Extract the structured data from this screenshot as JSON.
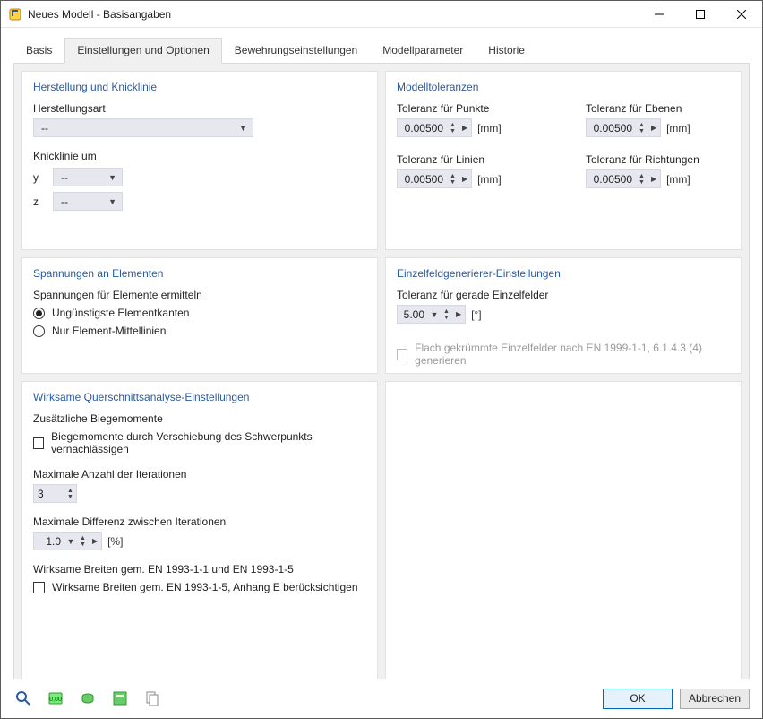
{
  "window": {
    "title": "Neues Modell - Basisangaben"
  },
  "tabs": {
    "basis": "Basis",
    "einstellungen": "Einstellungen und Optionen",
    "bewehrung": "Bewehrungseinstellungen",
    "modellparameter": "Modellparameter",
    "historie": "Historie"
  },
  "herstellung": {
    "title": "Herstellung und Knicklinie",
    "herstellungsart_label": "Herstellungsart",
    "herstellungsart_value": "--",
    "knicklinie_label": "Knicklinie um",
    "y_label": "y",
    "y_value": "--",
    "z_label": "z",
    "z_value": "--"
  },
  "toleranzen": {
    "title": "Modelltoleranzen",
    "punkte_label": "Toleranz für Punkte",
    "punkte_value": "0.00500",
    "ebenen_label": "Toleranz für Ebenen",
    "ebenen_value": "0.00500",
    "linien_label": "Toleranz für Linien",
    "linien_value": "0.00500",
    "richtungen_label": "Toleranz für Richtungen",
    "richtungen_value": "0.00500",
    "unit_mm": "[mm]"
  },
  "spannungen": {
    "title": "Spannungen an Elementen",
    "ermitteln_label": "Spannungen für Elemente ermitteln",
    "opt_kanten": "Ungünstigste Elementkanten",
    "opt_mittellinien": "Nur Element-Mittellinien"
  },
  "einzelfeld": {
    "title": "Einzelfeldgenerierer-Einstellungen",
    "tol_label": "Toleranz für gerade Einzelfelder",
    "tol_value": "5.00",
    "unit_deg": "[°]",
    "flach_label": "Flach gekrümmte Einzelfelder nach EN 1999-1-1, 6.1.4.3 (4) generieren"
  },
  "wqa": {
    "title": "Wirksame Querschnittsanalyse-Einstellungen",
    "zus_label": "Zusätzliche Biegemomente",
    "chk_biege": "Biegemomente durch Verschiebung des Schwerpunkts vernachlässigen",
    "max_iter_label": "Maximale Anzahl der Iterationen",
    "max_iter_value": "3",
    "max_diff_label": "Maximale Differenz zwischen Iterationen",
    "max_diff_value": "1.0",
    "unit_pct": "[%]",
    "wb_label": "Wirksame Breiten gem. EN 1993-1-1 und EN 1993-1-5",
    "chk_wb": "Wirksame Breiten gem. EN 1993-1-5, Anhang E berücksichtigen"
  },
  "footer": {
    "ok": "OK",
    "cancel": "Abbrechen"
  }
}
